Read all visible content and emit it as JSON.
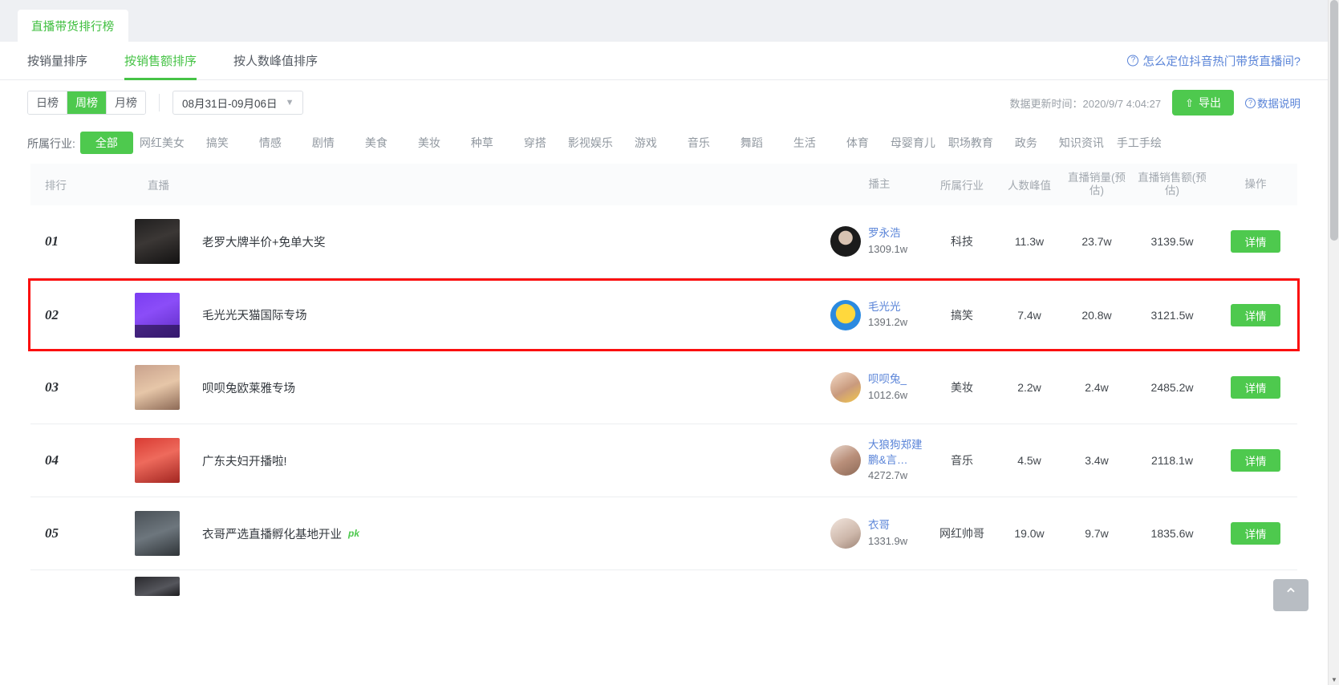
{
  "window": {
    "doc_tab": "直播带货排行榜"
  },
  "sortbar": {
    "tabs": [
      {
        "label": "按销量排序",
        "active": false
      },
      {
        "label": "按销售额排序",
        "active": true
      },
      {
        "label": "按人数峰值排序",
        "active": false
      }
    ],
    "help_icon": "question-circle-icon",
    "help_link": "怎么定位抖音热门带货直播间?"
  },
  "filterbar": {
    "period": [
      {
        "label": "日榜",
        "active": false
      },
      {
        "label": "周榜",
        "active": true
      },
      {
        "label": "月榜",
        "active": false
      }
    ],
    "date_range": "08月31日-09月06日",
    "date_chevron": "chevron-down-icon",
    "update_time": "数据更新时间：2020/9/7 4:04:27",
    "export_icon": "upload-icon",
    "export_label": "导出",
    "data_note_icon": "question-circle-icon",
    "data_note": "数据说明"
  },
  "industry": {
    "label": "所属行业:",
    "items": [
      {
        "label": "全部",
        "active": true
      },
      {
        "label": "网红美女",
        "active": false
      },
      {
        "label": "搞笑",
        "active": false
      },
      {
        "label": "情感",
        "active": false
      },
      {
        "label": "剧情",
        "active": false
      },
      {
        "label": "美食",
        "active": false
      },
      {
        "label": "美妆",
        "active": false
      },
      {
        "label": "种草",
        "active": false
      },
      {
        "label": "穿搭",
        "active": false
      },
      {
        "label": "影视娱乐",
        "active": false
      },
      {
        "label": "游戏",
        "active": false
      },
      {
        "label": "音乐",
        "active": false
      },
      {
        "label": "舞蹈",
        "active": false
      },
      {
        "label": "生活",
        "active": false
      },
      {
        "label": "体育",
        "active": false
      },
      {
        "label": "母婴育儿",
        "active": false
      },
      {
        "label": "职场教育",
        "active": false
      },
      {
        "label": "政务",
        "active": false
      },
      {
        "label": "知识资讯",
        "active": false
      },
      {
        "label": "手工手绘",
        "active": false
      }
    ]
  },
  "table": {
    "headers": {
      "rank": "排行",
      "live": "直播",
      "host": "播主",
      "industry": "所属行业",
      "peak": "人数峰值",
      "sales_l1": "直播销量(预",
      "sales_l2": "估)",
      "amount_l1": "直播销售额(预",
      "amount_l2": "估)",
      "operation": "操作"
    },
    "detail_label": "详情",
    "rows": [
      {
        "rank": "01",
        "title": "老罗大牌半价+免单大奖",
        "pk": "",
        "host_name": "罗永浩",
        "host_fans": "1309.1w",
        "industry": "科技",
        "peak": "11.3w",
        "sales": "23.7w",
        "amount": "3139.5w",
        "highlight": false,
        "cover_class": "img-a",
        "avatar_class": "av-a"
      },
      {
        "rank": "02",
        "title": "毛光光天猫国际专场",
        "pk": "",
        "host_name": "毛光光",
        "host_fans": "1391.2w",
        "industry": "搞笑",
        "peak": "7.4w",
        "sales": "20.8w",
        "amount": "3121.5w",
        "highlight": true,
        "cover_class": "img-b",
        "avatar_class": "av-b"
      },
      {
        "rank": "03",
        "title": "呗呗兔欧莱雅专场",
        "pk": "",
        "host_name": "呗呗兔_",
        "host_fans": "1012.6w",
        "industry": "美妆",
        "peak": "2.2w",
        "sales": "2.4w",
        "amount": "2485.2w",
        "highlight": false,
        "cover_class": "img-c",
        "avatar_class": "av-c"
      },
      {
        "rank": "04",
        "title": "广东夫妇开播啦!",
        "pk": "",
        "host_name": "大狼狗郑建鹏&言…",
        "host_fans": "4272.7w",
        "industry": "音乐",
        "peak": "4.5w",
        "sales": "3.4w",
        "amount": "2118.1w",
        "highlight": false,
        "cover_class": "img-d",
        "avatar_class": "av-d"
      },
      {
        "rank": "05",
        "title": "衣哥严选直播孵化基地开业",
        "pk": "pk",
        "host_name": "衣哥",
        "host_fans": "1331.9w",
        "industry": "网红帅哥",
        "peak": "19.0w",
        "sales": "9.7w",
        "amount": "1835.6w",
        "highlight": false,
        "cover_class": "img-e",
        "avatar_class": "av-e"
      }
    ]
  },
  "backtop_icon": "arrow-up-icon",
  "colors": {
    "accent": "#4ec94e",
    "link": "#5a84d8",
    "highlight": "#fb0f0f"
  }
}
